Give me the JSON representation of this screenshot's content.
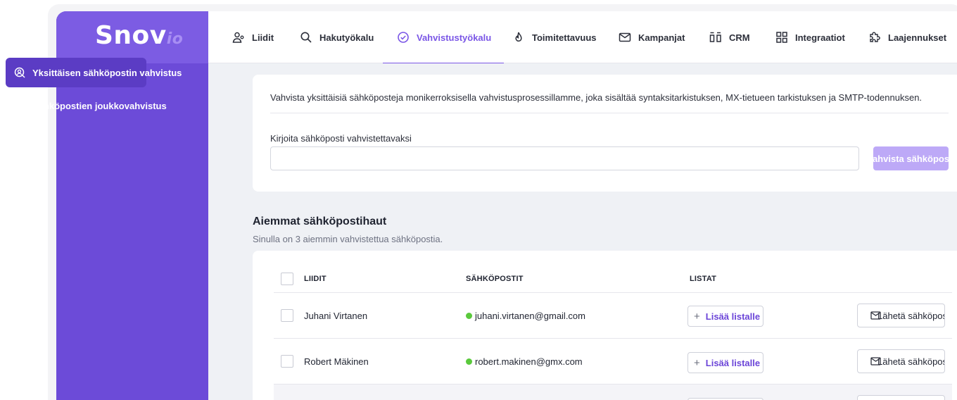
{
  "app": {
    "logo_main": "Snov",
    "logo_suffix": "io"
  },
  "sidebar": {
    "items": [
      {
        "label": "Yksittäisen sähköpostin vahvistus",
        "icon": "search-user-icon",
        "active": true
      },
      {
        "label": "Sähköpostien joukkovahvistus",
        "icon": "list-user-icon",
        "active": false
      }
    ]
  },
  "nav": {
    "tabs": [
      {
        "label": "Liidit",
        "icon": "users-icon"
      },
      {
        "label": "Hakutyökalu",
        "icon": "search-icon"
      },
      {
        "label": "Vahvistustyökalu",
        "icon": "check-circle-icon",
        "active": true
      },
      {
        "label": "Toimitettavuus",
        "icon": "flame-icon"
      },
      {
        "label": "Kampanjat",
        "icon": "mail-icon"
      },
      {
        "label": "CRM",
        "icon": "crm-icon"
      },
      {
        "label": "Integraatiot",
        "icon": "grid-icon"
      },
      {
        "label": "Laajennukset",
        "icon": "puzzle-icon"
      }
    ]
  },
  "verify": {
    "description": "Vahvista yksittäisiä sähköposteja monikerroksisella vahvistusprosessillamme, joka sisältää syntaksitarkistuksen, MX-tietueen tarkistuksen ja SMTP-todennuksen.",
    "input_label": "Kirjoita sähköposti vahvistettavaksi",
    "input_value": "",
    "button_label": "Vahvista sähköposti"
  },
  "history": {
    "title": "Aiemmat sähköpostihaut",
    "subtitle": "Sinulla on 3 aiemmin vahvistettua sähköpostia.",
    "columns": {
      "leads": "LIIDIT",
      "emails": "SÄHKÖPOSTIT",
      "lists": "LISTAT"
    },
    "add_to_list_label": "Lisää listalle",
    "send_email_label": "Lähetä sähköposti",
    "rows": [
      {
        "name": "Juhani Virtanen",
        "email": "juhani.virtanen@gmail.com",
        "status_color": "#5ac93c"
      },
      {
        "name": "Robert Mäkinen",
        "email": "robert.makinen@gmx.com",
        "status_color": "#5ac93c"
      }
    ]
  },
  "colors": {
    "brand": "#6c4bd8",
    "accent": "#7a56e6",
    "valid": "#5ac93c"
  }
}
